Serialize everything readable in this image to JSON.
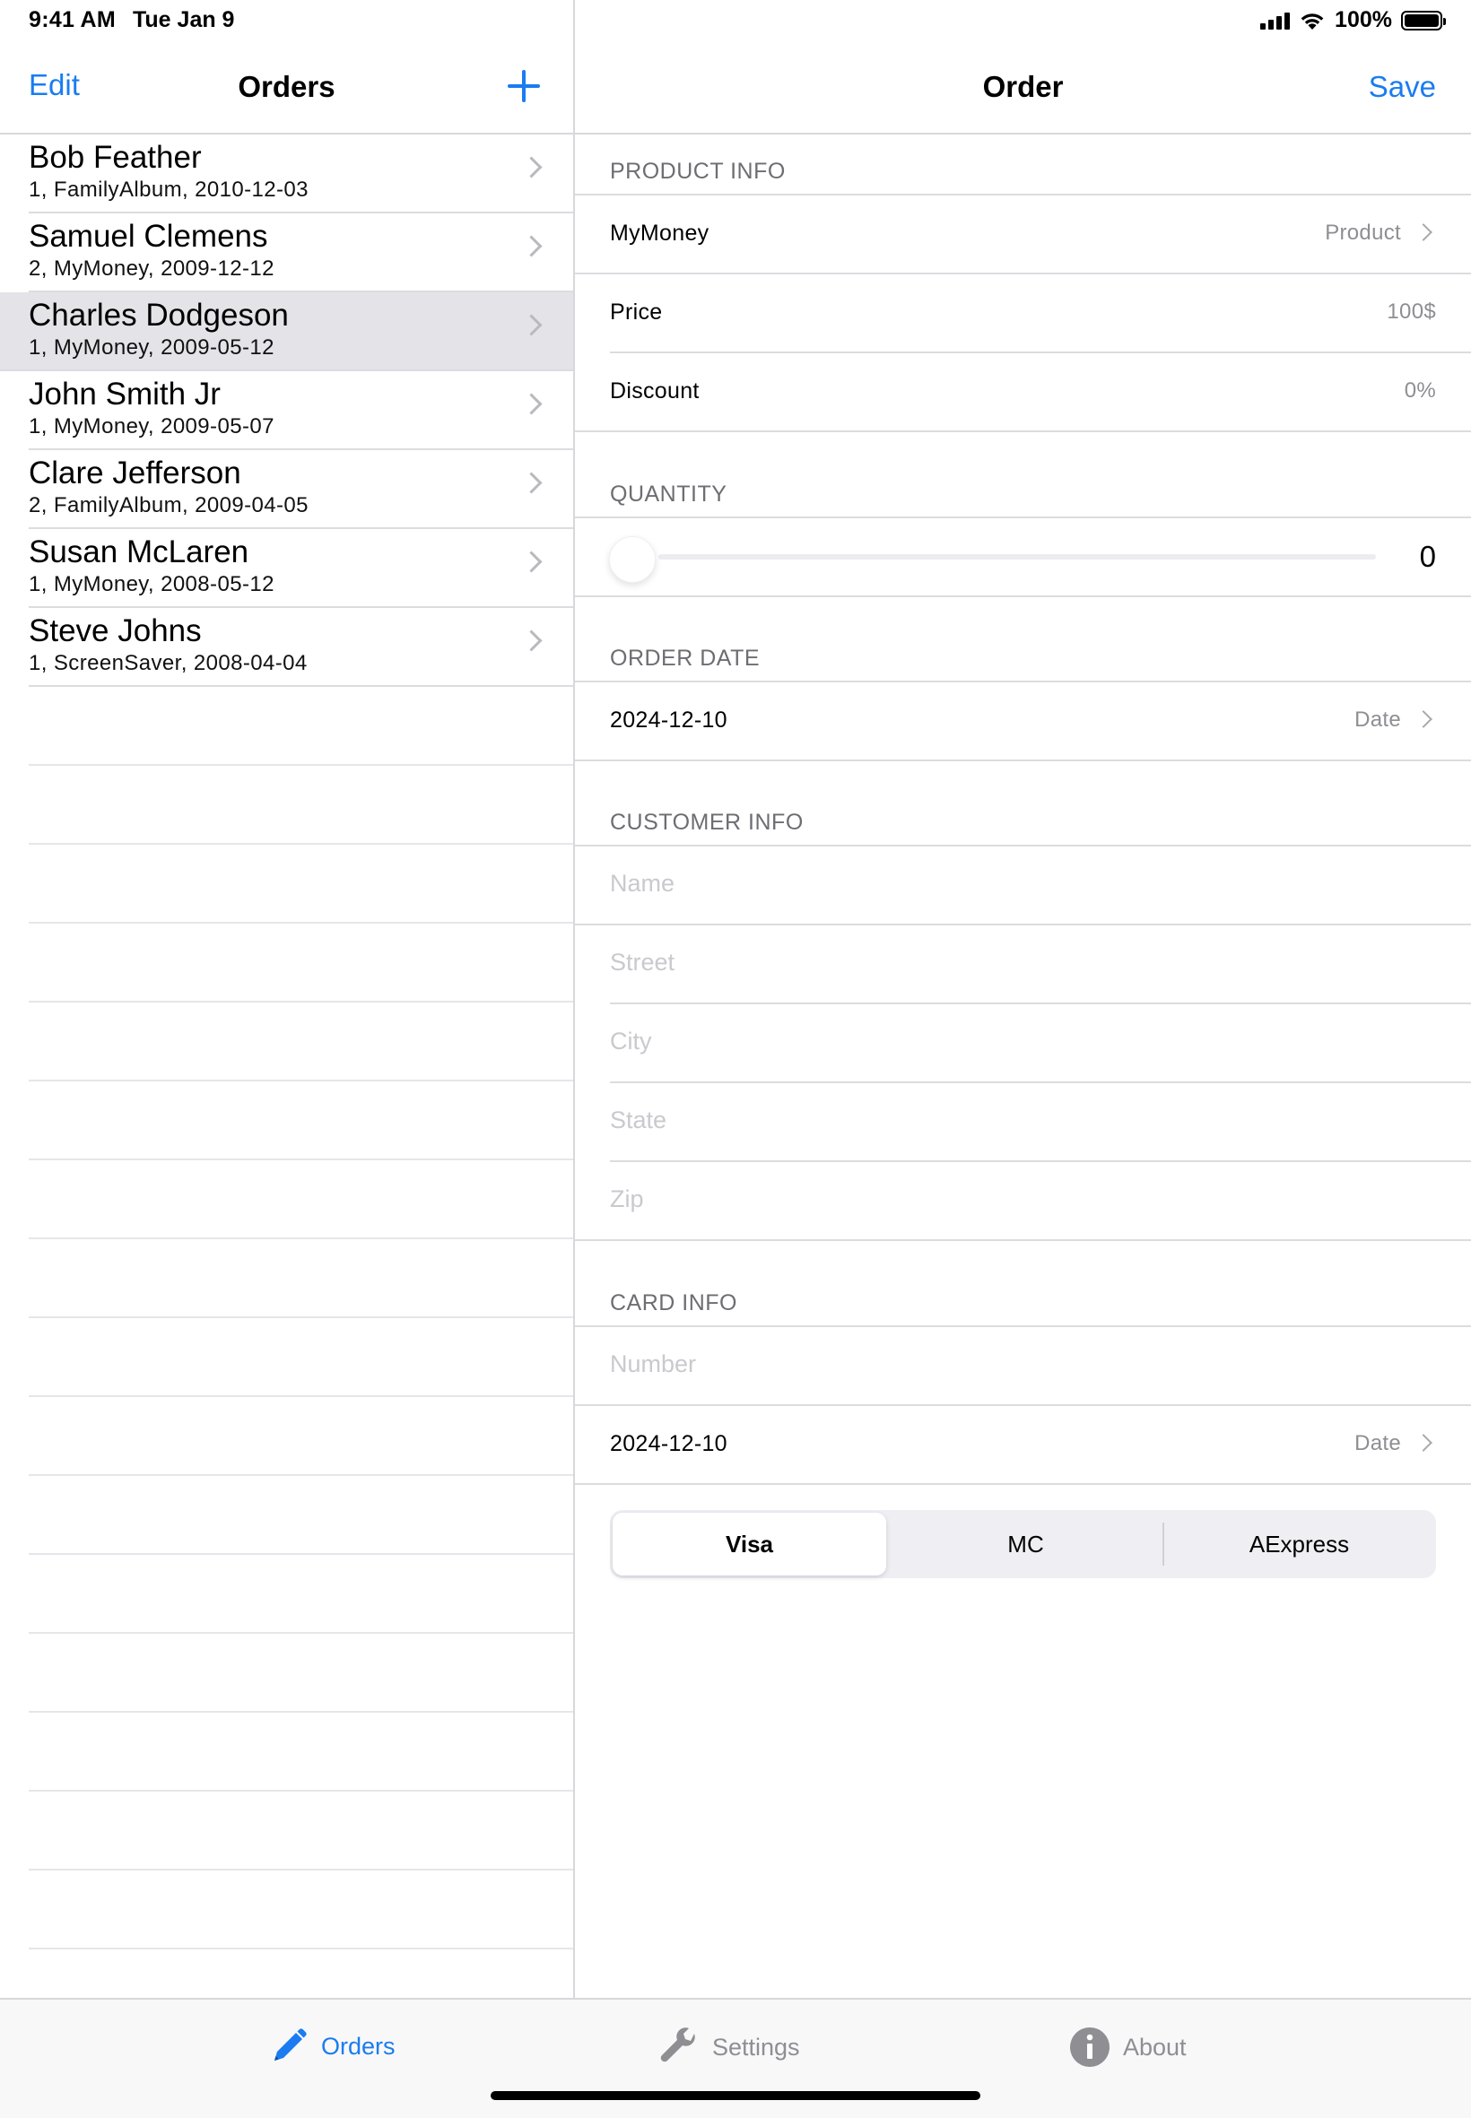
{
  "status_bar": {
    "time": "9:41 AM",
    "date": "Tue Jan 9",
    "battery": "100%"
  },
  "master": {
    "edit_label": "Edit",
    "title": "Orders",
    "add_icon": "plus-icon",
    "orders": [
      {
        "name": "Bob Feather",
        "details": "1, FamilyAlbum, 2010-12-03"
      },
      {
        "name": "Samuel Clemens",
        "details": "2, MyMoney, 2009-12-12"
      },
      {
        "name": "Charles Dodgeson",
        "details": "1, MyMoney, 2009-05-12"
      },
      {
        "name": "John Smith Jr",
        "details": "1, MyMoney, 2009-05-07"
      },
      {
        "name": "Clare Jefferson",
        "details": "2, FamilyAlbum, 2009-04-05"
      },
      {
        "name": "Susan McLaren",
        "details": "1, MyMoney, 2008-05-12"
      },
      {
        "name": "Steve Johns",
        "details": "1, ScreenSaver, 2008-04-04"
      }
    ],
    "selected_index": 2
  },
  "detail": {
    "title": "Order",
    "save_label": "Save",
    "product_info": {
      "header": "PRODUCT INFO",
      "product": {
        "label": "MyMoney",
        "value": "Product"
      },
      "price": {
        "label": "Price",
        "value": "100$"
      },
      "discount": {
        "label": "Discount",
        "value": "0%"
      }
    },
    "quantity": {
      "header": "QUANTITY",
      "value": "0",
      "fraction": 0
    },
    "order_date": {
      "header": "ORDER DATE",
      "label": "2024-12-10",
      "value": "Date"
    },
    "customer_info": {
      "header": "CUSTOMER INFO",
      "placeholders": {
        "name": "Name",
        "street": "Street",
        "city": "City",
        "state": "State",
        "zip": "Zip"
      }
    },
    "card_info": {
      "header": "CARD INFO",
      "number_placeholder": "Number",
      "expiry": {
        "label": "2024-12-10",
        "value": "Date"
      },
      "card_types": [
        "Visa",
        "MC",
        "AExpress"
      ],
      "selected_card": "Visa"
    }
  },
  "tab_bar": {
    "tabs": [
      {
        "label": "Orders",
        "icon": "pencil-icon",
        "active": true
      },
      {
        "label": "Settings",
        "icon": "wrench-icon",
        "active": false
      },
      {
        "label": "About",
        "icon": "info-icon",
        "active": false
      }
    ]
  },
  "colors": {
    "accent": "#1a7cf0",
    "selected_row": "#e3e3e8",
    "separator": "#dcdce0"
  }
}
